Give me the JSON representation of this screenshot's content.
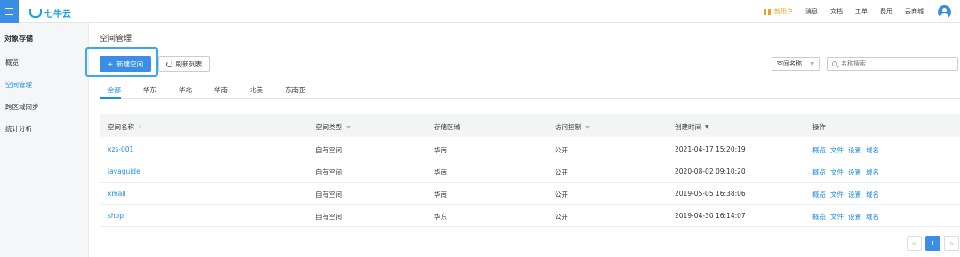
{
  "brand": {
    "name": "七牛云"
  },
  "topnav": {
    "promo": "新用户",
    "items": [
      "消息",
      "文档",
      "工单",
      "费用",
      "云商城"
    ]
  },
  "sidebar": {
    "section": "对象存储",
    "items": [
      "概览",
      "空间管理",
      "跨区域同步",
      "统计分析"
    ],
    "active": "空间管理"
  },
  "page": {
    "title": "空间管理"
  },
  "toolbar": {
    "new_label": "新建空间",
    "refresh_label": "刷新列表",
    "filter_select": "空间名称",
    "search_placeholder": "名称搜索"
  },
  "tabs": [
    "全部",
    "华东",
    "华北",
    "华南",
    "北美",
    "东南亚"
  ],
  "table": {
    "headers": [
      "空间名称",
      "空间类型",
      "存储区域",
      "访问控制",
      "创建时间",
      "操作"
    ],
    "rows": [
      {
        "name": "xzs-001",
        "type": "自有空间",
        "region": "华南",
        "access": "公开",
        "created": "2021-04-17 15:20:19"
      },
      {
        "name": "javaguide",
        "type": "自有空间",
        "region": "华南",
        "access": "公开",
        "created": "2020-08-02 09:10:20"
      },
      {
        "name": "xmall",
        "type": "自有空间",
        "region": "华南",
        "access": "公开",
        "created": "2019-05-05 16:38:06"
      },
      {
        "name": "shop",
        "type": "自有空间",
        "region": "华东",
        "access": "公开",
        "created": "2019-04-30 16:14:07"
      }
    ],
    "ops": [
      "概览",
      "文件",
      "设置",
      "域名"
    ]
  },
  "pagination": {
    "prev": "<",
    "current": "1",
    "next": ">"
  },
  "colors": {
    "primary": "#3a8ee6",
    "link": "#1a8ee0",
    "promo": "#f0a020"
  }
}
